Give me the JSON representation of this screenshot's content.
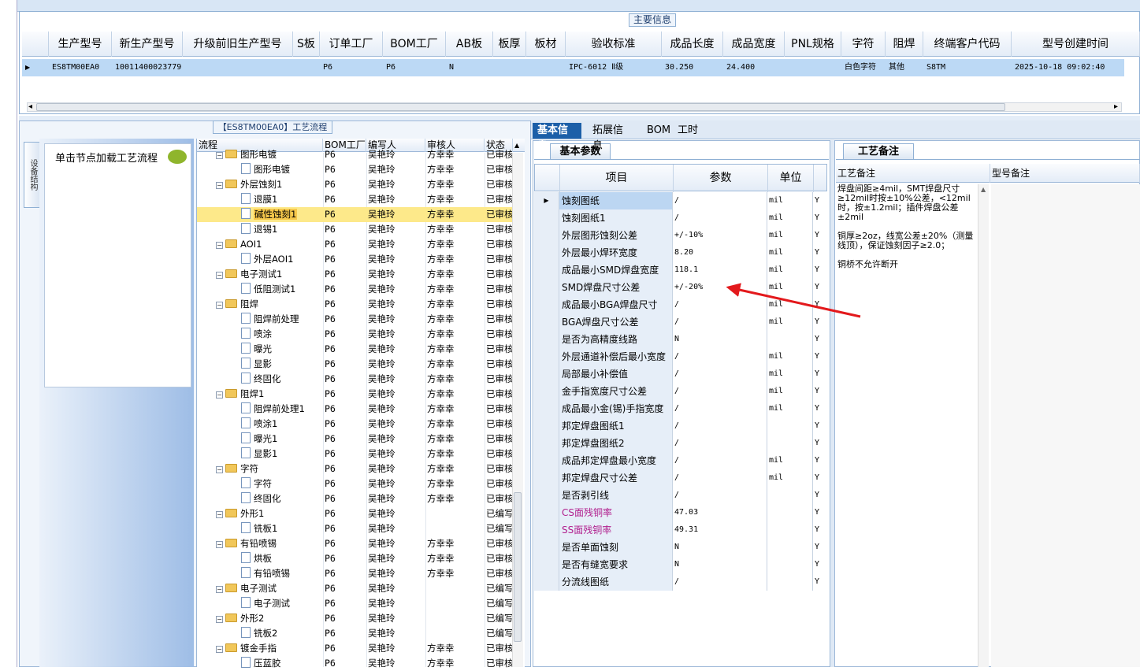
{
  "main_info": {
    "title": "主要信息",
    "headers": [
      "生产型号",
      "新生产型号",
      "升级前旧生产型号",
      "S板",
      "订单工厂",
      "BOM工厂",
      "AB板",
      "板厚",
      "板材",
      "验收标准",
      "成品长度",
      "成品宽度",
      "PNL规格",
      "字符",
      "阻焊",
      "终端客户代码",
      "型号创建时间"
    ],
    "row": {
      "indicator": "▶",
      "cells": [
        "ES8TM00EA0",
        "10011400023779",
        "",
        "",
        "P6",
        "P6",
        "N",
        "",
        "",
        "IPC-6012 Ⅱ级",
        "30.250",
        "24.400",
        "",
        "白色字符",
        "其他",
        "S8TM",
        "2025-10-18 09:02:40"
      ]
    },
    "scroll_left": "◂",
    "scroll_right": "▸"
  },
  "flow_panel": {
    "title": "【ES8TM00EA0】工艺流程",
    "side_tab": "设备结构",
    "load_text": "单击节点加载工艺流程",
    "headers": [
      "流程",
      "BOM工厂",
      "编写人",
      "审核人",
      "状态"
    ],
    "rows": [
      {
        "kind": "folder",
        "name": "图形电镀",
        "bom": "P6",
        "writer": "吴艳玲",
        "reviewer": "方幸幸",
        "status": "已审核"
      },
      {
        "kind": "doc",
        "name": "图形电镀",
        "bom": "P6",
        "writer": "吴艳玲",
        "reviewer": "方幸幸",
        "status": "已审核"
      },
      {
        "kind": "folder",
        "name": "外层蚀刻1",
        "bom": "P6",
        "writer": "吴艳玲",
        "reviewer": "方幸幸",
        "status": "已审核"
      },
      {
        "kind": "doc",
        "name": "退膜1",
        "bom": "P6",
        "writer": "吴艳玲",
        "reviewer": "方幸幸",
        "status": "已审核"
      },
      {
        "kind": "doc",
        "name": "碱性蚀刻1",
        "bom": "P6",
        "writer": "吴艳玲",
        "reviewer": "方幸幸",
        "status": "已审核",
        "selected": true
      },
      {
        "kind": "doc",
        "name": "退锡1",
        "bom": "P6",
        "writer": "吴艳玲",
        "reviewer": "方幸幸",
        "status": "已审核"
      },
      {
        "kind": "folder",
        "name": "AOI1",
        "bom": "P6",
        "writer": "吴艳玲",
        "reviewer": "方幸幸",
        "status": "已审核"
      },
      {
        "kind": "doc",
        "name": "外层AOI1",
        "bom": "P6",
        "writer": "吴艳玲",
        "reviewer": "方幸幸",
        "status": "已审核"
      },
      {
        "kind": "folder",
        "name": "电子测试1",
        "bom": "P6",
        "writer": "吴艳玲",
        "reviewer": "方幸幸",
        "status": "已审核"
      },
      {
        "kind": "doc",
        "name": "低阻测试1",
        "bom": "P6",
        "writer": "吴艳玲",
        "reviewer": "方幸幸",
        "status": "已审核"
      },
      {
        "kind": "folder",
        "name": "阻焊",
        "bom": "P6",
        "writer": "吴艳玲",
        "reviewer": "方幸幸",
        "status": "已审核"
      },
      {
        "kind": "doc",
        "name": "阻焊前处理",
        "bom": "P6",
        "writer": "吴艳玲",
        "reviewer": "方幸幸",
        "status": "已审核"
      },
      {
        "kind": "doc",
        "name": "喷涂",
        "bom": "P6",
        "writer": "吴艳玲",
        "reviewer": "方幸幸",
        "status": "已审核"
      },
      {
        "kind": "doc",
        "name": "曝光",
        "bom": "P6",
        "writer": "吴艳玲",
        "reviewer": "方幸幸",
        "status": "已审核"
      },
      {
        "kind": "doc",
        "name": "显影",
        "bom": "P6",
        "writer": "吴艳玲",
        "reviewer": "方幸幸",
        "status": "已审核"
      },
      {
        "kind": "doc",
        "name": "终固化",
        "bom": "P6",
        "writer": "吴艳玲",
        "reviewer": "方幸幸",
        "status": "已审核"
      },
      {
        "kind": "folder",
        "name": "阻焊1",
        "bom": "P6",
        "writer": "吴艳玲",
        "reviewer": "方幸幸",
        "status": "已审核"
      },
      {
        "kind": "doc",
        "name": "阻焊前处理1",
        "bom": "P6",
        "writer": "吴艳玲",
        "reviewer": "方幸幸",
        "status": "已审核"
      },
      {
        "kind": "doc",
        "name": "喷涂1",
        "bom": "P6",
        "writer": "吴艳玲",
        "reviewer": "方幸幸",
        "status": "已审核"
      },
      {
        "kind": "doc",
        "name": "曝光1",
        "bom": "P6",
        "writer": "吴艳玲",
        "reviewer": "方幸幸",
        "status": "已审核"
      },
      {
        "kind": "doc",
        "name": "显影1",
        "bom": "P6",
        "writer": "吴艳玲",
        "reviewer": "方幸幸",
        "status": "已审核"
      },
      {
        "kind": "folder",
        "name": "字符",
        "bom": "P6",
        "writer": "吴艳玲",
        "reviewer": "方幸幸",
        "status": "已审核"
      },
      {
        "kind": "doc",
        "name": "字符",
        "bom": "P6",
        "writer": "吴艳玲",
        "reviewer": "方幸幸",
        "status": "已审核"
      },
      {
        "kind": "doc",
        "name": "终固化",
        "bom": "P6",
        "writer": "吴艳玲",
        "reviewer": "方幸幸",
        "status": "已审核"
      },
      {
        "kind": "folder",
        "name": "外形1",
        "bom": "P6",
        "writer": "吴艳玲",
        "reviewer": "",
        "status": "已编写"
      },
      {
        "kind": "doc",
        "name": "铣板1",
        "bom": "P6",
        "writer": "吴艳玲",
        "reviewer": "",
        "status": "已编写"
      },
      {
        "kind": "folder",
        "name": "有铅喷锡",
        "bom": "P6",
        "writer": "吴艳玲",
        "reviewer": "方幸幸",
        "status": "已审核"
      },
      {
        "kind": "doc",
        "name": "烘板",
        "bom": "P6",
        "writer": "吴艳玲",
        "reviewer": "方幸幸",
        "status": "已审核"
      },
      {
        "kind": "doc",
        "name": "有铅喷锡",
        "bom": "P6",
        "writer": "吴艳玲",
        "reviewer": "方幸幸",
        "status": "已审核"
      },
      {
        "kind": "folder",
        "name": "电子测试",
        "bom": "P6",
        "writer": "吴艳玲",
        "reviewer": "",
        "status": "已编写"
      },
      {
        "kind": "doc",
        "name": "电子测试",
        "bom": "P6",
        "writer": "吴艳玲",
        "reviewer": "",
        "status": "已编写"
      },
      {
        "kind": "folder",
        "name": "外形2",
        "bom": "P6",
        "writer": "吴艳玲",
        "reviewer": "",
        "status": "已编写"
      },
      {
        "kind": "doc",
        "name": "铣板2",
        "bom": "P6",
        "writer": "吴艳玲",
        "reviewer": "",
        "status": "已编写"
      },
      {
        "kind": "folder",
        "name": "镀金手指",
        "bom": "P6",
        "writer": "吴艳玲",
        "reviewer": "方幸幸",
        "status": "已审核"
      },
      {
        "kind": "doc",
        "name": "压蓝胶",
        "bom": "P6",
        "writer": "吴艳玲",
        "reviewer": "方幸幸",
        "status": "已审核"
      }
    ]
  },
  "detail_tabs": [
    "基本信息",
    "拓展信息",
    "BOM",
    "工时"
  ],
  "params": {
    "subtab": "基本参数",
    "headers": [
      "项目",
      "参数",
      "单位"
    ],
    "rows": [
      {
        "name": "蚀刻图纸",
        "value": "/",
        "unit": "mil",
        "flag": "Y",
        "current": true
      },
      {
        "name": "蚀刻图纸1",
        "value": "/",
        "unit": "mil",
        "flag": "Y"
      },
      {
        "name": "外层图形蚀刻公差",
        "value": "+/-10%",
        "unit": "mil",
        "flag": "Y"
      },
      {
        "name": "外层最小焊环宽度",
        "value": "8.20",
        "unit": "mil",
        "flag": "Y"
      },
      {
        "name": "成品最小SMD焊盘宽度",
        "value": "118.1",
        "unit": "mil",
        "flag": "Y"
      },
      {
        "name": "SMD焊盘尺寸公差",
        "value": "+/-20%",
        "unit": "mil",
        "flag": "Y"
      },
      {
        "name": "成品最小BGA焊盘尺寸",
        "value": "/",
        "unit": "mil",
        "flag": "Y"
      },
      {
        "name": "BGA焊盘尺寸公差",
        "value": "/",
        "unit": "mil",
        "flag": "Y"
      },
      {
        "name": "是否为高精度线路",
        "value": "N",
        "unit": "",
        "flag": "Y"
      },
      {
        "name": "外层通道补偿后最小宽度",
        "value": "/",
        "unit": "mil",
        "flag": "Y"
      },
      {
        "name": "局部最小补偿值",
        "value": "/",
        "unit": "mil",
        "flag": "Y"
      },
      {
        "name": "金手指宽度尺寸公差",
        "value": "/",
        "unit": "mil",
        "flag": "Y"
      },
      {
        "name": "成品最小金(锡)手指宽度",
        "value": "/",
        "unit": "mil",
        "flag": "Y"
      },
      {
        "name": "邦定焊盘图纸1",
        "value": "/",
        "unit": "",
        "flag": "Y"
      },
      {
        "name": "邦定焊盘图纸2",
        "value": "/",
        "unit": "",
        "flag": "Y"
      },
      {
        "name": "成品邦定焊盘最小宽度",
        "value": "/",
        "unit": "mil",
        "flag": "Y"
      },
      {
        "name": "邦定焊盘尺寸公差",
        "value": "/",
        "unit": "mil",
        "flag": "Y"
      },
      {
        "name": "是否剥引线",
        "value": "/",
        "unit": "",
        "flag": "Y"
      },
      {
        "name": "CS面残铜率",
        "value": "47.03",
        "unit": "",
        "flag": "Y",
        "pink": true
      },
      {
        "name": "SS面残铜率",
        "value": "49.31",
        "unit": "",
        "flag": "Y",
        "pink": true
      },
      {
        "name": "是否单面蚀刻",
        "value": "N",
        "unit": "",
        "flag": "Y"
      },
      {
        "name": "是否有缝宽要求",
        "value": "N",
        "unit": "",
        "flag": "Y"
      },
      {
        "name": "分流线图纸",
        "value": "/",
        "unit": "",
        "flag": "Y"
      }
    ]
  },
  "notes": {
    "tab": "工艺备注",
    "headers": [
      "工艺备注",
      "型号备注"
    ],
    "process_note": "焊盘间距≥4mil，SMT焊盘尺寸≥12mil时按±10%公差，<12mil时，按±1.2mil；插件焊盘公差±2mil\n\n铜厚≥2oz，线宽公差±20%（测量线顶），保证蚀刻因子≥2.0；\n\n铜桥不允许断开"
  },
  "colors": {
    "selection": "#fde98a",
    "active_tab": "#1c5fa8",
    "highlight_row": "#bcd9f5",
    "annotation_arrow": "#e3191c",
    "pink_text": "#b1208e"
  }
}
